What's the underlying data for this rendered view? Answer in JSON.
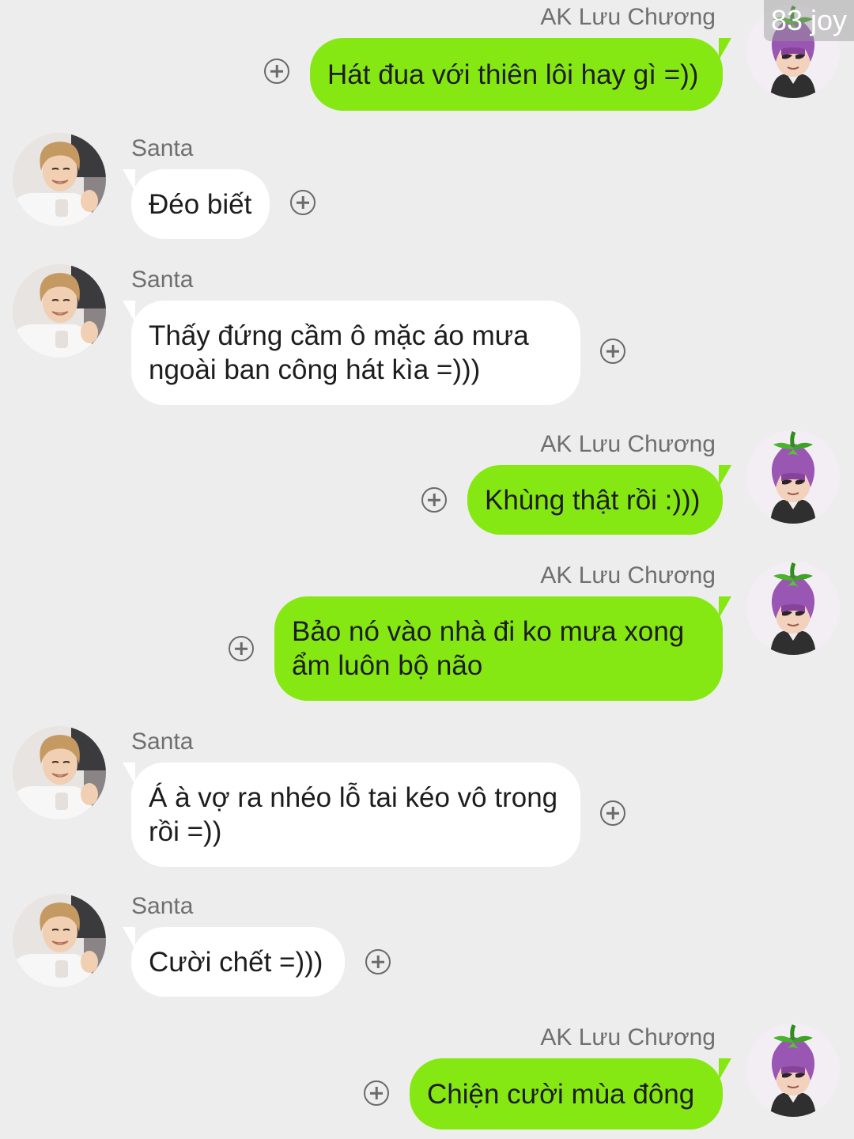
{
  "watermark": "83 joy",
  "users": {
    "me": {
      "name": "AK Lưu Chương",
      "avatar": "eggplant-hat-avatar"
    },
    "other": {
      "name": "Santa",
      "avatar": "smiling-boy-avatar"
    }
  },
  "messages": [
    {
      "sender": "AK Lưu Chương",
      "text": "Hát đua với thiên lôi hay gì =))"
    },
    {
      "sender": "Santa",
      "text": "Đéo biết"
    },
    {
      "sender": "Santa",
      "text": "Thấy đứng cầm ô mặc áo mưa\nngoài ban công hát kìa =)))"
    },
    {
      "sender": "AK Lưu Chương",
      "text": "Khùng thật rồi :)))"
    },
    {
      "sender": "AK Lưu Chương",
      "text": "Bảo nó vào nhà đi ko mưa xong\nẩm luôn bộ não"
    },
    {
      "sender": "Santa",
      "text": "Á à vợ ra nhéo lỗ tai kéo vô trong\nrồi =))"
    },
    {
      "sender": "Santa",
      "text": "Cười chết =)))"
    },
    {
      "sender": "AK Lưu Chương",
      "text": "Chiện cười mùa đông"
    }
  ],
  "colors": {
    "background": "#ededed",
    "my_bubble": "#86e813",
    "their_bubble": "#ffffff",
    "name_text": "#6f6f6f"
  }
}
